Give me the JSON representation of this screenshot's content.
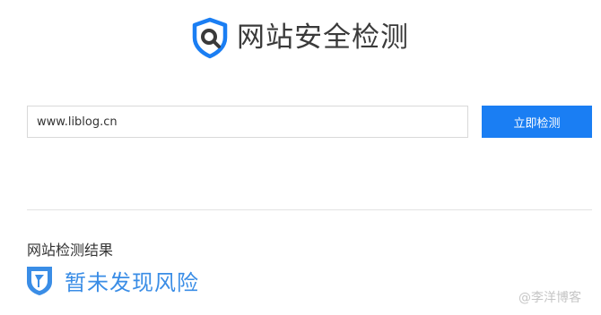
{
  "header": {
    "logo_icon": "shield-search-icon",
    "title": "网站安全检测"
  },
  "search": {
    "value": "www.liblog.cn",
    "button_label": "立即检测"
  },
  "result": {
    "heading": "网站检测结果",
    "status_icon": "shield-check-icon",
    "status_text": "暂未发现风险"
  },
  "watermark": "@李洋博客",
  "colors": {
    "accent": "#1a7ef3",
    "result_text": "#3a8de6",
    "title_text": "#3a3a3a",
    "divider": "#e3e3e3"
  }
}
